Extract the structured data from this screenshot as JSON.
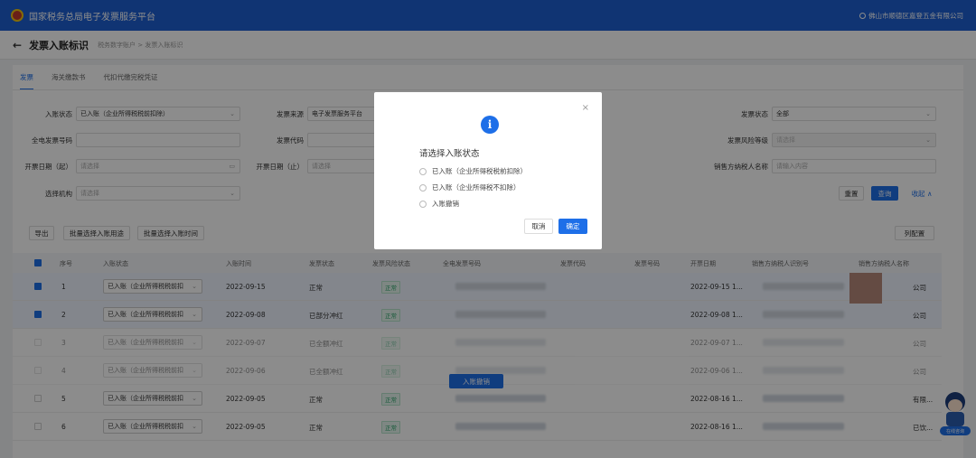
{
  "app": {
    "brand": "国家税务总局电子发票服务平台",
    "user": "佛山市顺德区嘉登五金有限公司"
  },
  "header": {
    "back": "←",
    "title": "发票入账标识",
    "breadcrumb": "税务数字账户 > 发票入账标识"
  },
  "tabs": [
    "发票",
    "海关缴款书",
    "代扣代缴完税凭证"
  ],
  "filters": {
    "entry_status": {
      "label": "入账状态",
      "value": "已入账（企业所得税税前扣除）"
    },
    "invoice_source": {
      "label": "发票来源",
      "value": "电子发票服务平台"
    },
    "invoice_status": {
      "label": "发票状态",
      "value": "全部"
    },
    "full_invoice_no": {
      "label": "全电发票号码",
      "value": ""
    },
    "invoice_code": {
      "label": "发票代码",
      "value": ""
    },
    "risk_level": {
      "label": "发票风险等级",
      "placeholder": "请选择"
    },
    "date_start": {
      "label": "开票日期（起）",
      "placeholder": "请选择"
    },
    "date_end": {
      "label": "开票日期（止）",
      "placeholder": "请选择"
    },
    "seller_name": {
      "label": "销售方纳税人名称",
      "placeholder": "请输入内容"
    },
    "org": {
      "label": "选择机构",
      "placeholder": "请选择"
    }
  },
  "actions": {
    "reset": "重置",
    "query": "查询",
    "collapse": "收起 ∧",
    "export": "导出",
    "batch_usage": "批量选择入账用途",
    "batch_time": "批量选择入账时间",
    "columns": "列配置",
    "entry_cancel": "入账撤销"
  },
  "table": {
    "headers": [
      "序号",
      "入账状态",
      "入账时间",
      "发票状态",
      "发票风险状态",
      "全电发票号码",
      "发票代码",
      "发票号码",
      "开票日期",
      "销售方纳税人识别号",
      "销售方纳税人名称"
    ],
    "rows": [
      {
        "no": "1",
        "status": "已入账（企业所得税税前扣",
        "time": "2022-09-15",
        "inv_status": "正常",
        "risk": "正常",
        "date": "2022-09-15 1...",
        "seller_tail": "公司",
        "checked": true,
        "dim": false
      },
      {
        "no": "2",
        "status": "已入账（企业所得税税前扣",
        "time": "2022-09-08",
        "inv_status": "已部分冲红",
        "risk": "正常",
        "date": "2022-09-08 1...",
        "seller_tail": "公司",
        "checked": true,
        "dim": false
      },
      {
        "no": "3",
        "status": "已入账（企业所得税税前扣",
        "time": "2022-09-07",
        "inv_status": "已全额冲红",
        "risk": "正常",
        "date": "2022-09-07 1...",
        "seller_tail": "公司",
        "checked": false,
        "dim": true
      },
      {
        "no": "4",
        "status": "已入账（企业所得税税前扣",
        "time": "2022-09-06",
        "inv_status": "已全额冲红",
        "risk": "正常",
        "date": "2022-09-06 1...",
        "seller_tail": "公司",
        "checked": false,
        "dim": true
      },
      {
        "no": "5",
        "status": "已入账（企业所得税税前扣",
        "time": "2022-09-05",
        "inv_status": "正常",
        "risk": "正常",
        "date": "2022-08-16 1...",
        "seller_tail": "有限...",
        "checked": false,
        "dim": false
      },
      {
        "no": "6",
        "status": "已入账（企业所得税税前扣",
        "time": "2022-09-05",
        "inv_status": "正常",
        "risk": "正常",
        "date": "2022-08-16 1...",
        "seller_tail": "已饮...",
        "checked": false,
        "dim": false
      }
    ]
  },
  "modal": {
    "close": "×",
    "icon": "i",
    "title": "请选择入账状态",
    "options": [
      "已入账（企业所得税税前扣除）",
      "已入账（企业所得税不扣除）",
      "入账撤销"
    ],
    "cancel": "取消",
    "confirm": "确定"
  },
  "mascot": {
    "label": "在线咨询"
  },
  "colors": {
    "primary": "#1e6fe8",
    "topbar": "#1e5fd1"
  }
}
